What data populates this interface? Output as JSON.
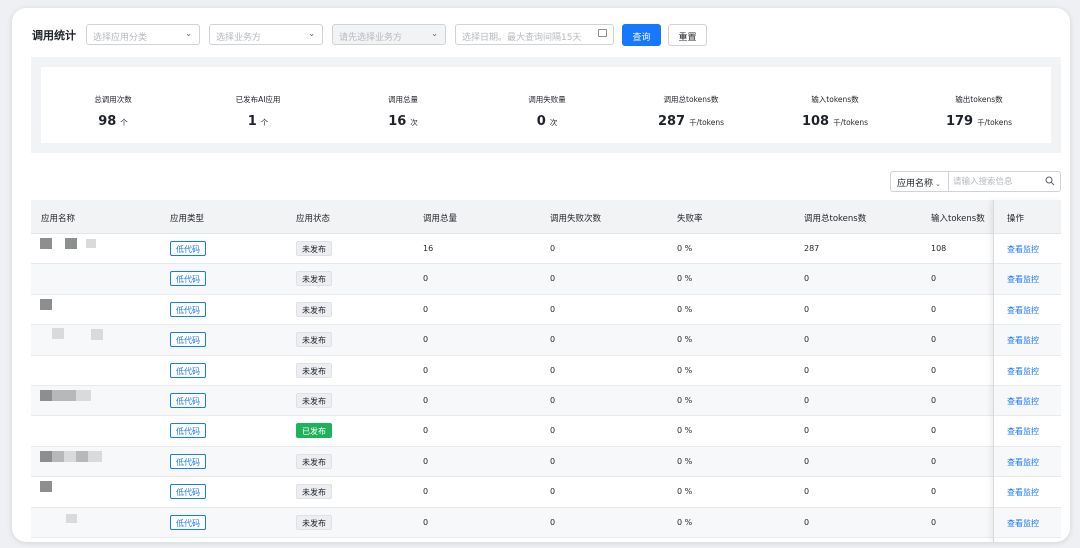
{
  "page_title": "调用统计",
  "filters": {
    "app_category_placeholder": "选择应用分类",
    "business_placeholder": "选择业务方",
    "app_placeholder_disabled": "请先选择业务方",
    "date_placeholder": "选择日期。最大查询间隔15天",
    "query_label": "查询",
    "reset_label": "重置"
  },
  "stats": [
    {
      "label": "总调用次数",
      "value": "98",
      "unit": "个"
    },
    {
      "label": "已发布AI应用",
      "value": "1",
      "unit": "个"
    },
    {
      "label": "调用总量",
      "value": "16",
      "unit": "次"
    },
    {
      "label": "调用失败量",
      "value": "0",
      "unit": "次"
    },
    {
      "label": "调用总tokens数",
      "value": "287",
      "unit": "千/tokens"
    },
    {
      "label": "输入tokens数",
      "value": "108",
      "unit": "千/tokens"
    },
    {
      "label": "输出tokens数",
      "value": "179",
      "unit": "千/tokens"
    }
  ],
  "search": {
    "field_label": "应用名称",
    "placeholder": "请输入搜索信息"
  },
  "table": {
    "headers": [
      "应用名称",
      "应用类型",
      "应用状态",
      "调用总量",
      "调用失败次数",
      "失败率",
      "调用总tokens数",
      "输入tokens数",
      "操作"
    ],
    "rows": [
      {
        "type": "低代码",
        "status": "未发布",
        "published": false,
        "calls": "16",
        "failures": "0",
        "fail_rate": "0 %",
        "total_tokens": "287",
        "input_tokens": "108",
        "action": "查看监控"
      },
      {
        "type": "低代码",
        "status": "未发布",
        "published": false,
        "calls": "0",
        "failures": "0",
        "fail_rate": "0 %",
        "total_tokens": "0",
        "input_tokens": "0",
        "action": "查看监控"
      },
      {
        "type": "低代码",
        "status": "未发布",
        "published": false,
        "calls": "0",
        "failures": "0",
        "fail_rate": "0 %",
        "total_tokens": "0",
        "input_tokens": "0",
        "action": "查看监控"
      },
      {
        "type": "低代码",
        "status": "未发布",
        "published": false,
        "calls": "0",
        "failures": "0",
        "fail_rate": "0 %",
        "total_tokens": "0",
        "input_tokens": "0",
        "action": "查看监控"
      },
      {
        "type": "低代码",
        "status": "未发布",
        "published": false,
        "calls": "0",
        "failures": "0",
        "fail_rate": "0 %",
        "total_tokens": "0",
        "input_tokens": "0",
        "action": "查看监控"
      },
      {
        "type": "低代码",
        "status": "未发布",
        "published": false,
        "calls": "0",
        "failures": "0",
        "fail_rate": "0 %",
        "total_tokens": "0",
        "input_tokens": "0",
        "action": "查看监控"
      },
      {
        "type": "低代码",
        "status": "已发布",
        "published": true,
        "calls": "0",
        "failures": "0",
        "fail_rate": "0 %",
        "total_tokens": "0",
        "input_tokens": "0",
        "action": "查看监控"
      },
      {
        "type": "低代码",
        "status": "未发布",
        "published": false,
        "calls": "0",
        "failures": "0",
        "fail_rate": "0 %",
        "total_tokens": "0",
        "input_tokens": "0",
        "action": "查看监控"
      },
      {
        "type": "低代码",
        "status": "未发布",
        "published": false,
        "calls": "0",
        "failures": "0",
        "fail_rate": "0 %",
        "total_tokens": "0",
        "input_tokens": "0",
        "action": "查看监控"
      },
      {
        "type": "低代码",
        "status": "未发布",
        "published": false,
        "calls": "0",
        "failures": "0",
        "fail_rate": "0 %",
        "total_tokens": "0",
        "input_tokens": "0",
        "action": "查看监控"
      }
    ]
  },
  "colors": {
    "primary": "#1677ff",
    "published": "#1fb25a"
  }
}
